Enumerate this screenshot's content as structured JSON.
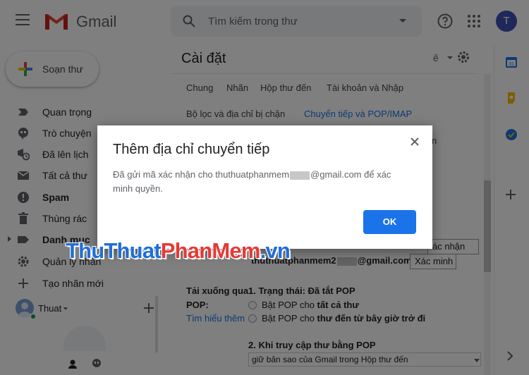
{
  "app": {
    "logo_text": "Gmail"
  },
  "search": {
    "placeholder": "Tìm kiếm trong thư"
  },
  "account": {
    "avatar_letter": "T"
  },
  "compose": {
    "label": "Soạn thư"
  },
  "sidebar": {
    "items": [
      {
        "label": "Quan trọng",
        "icon": "label-important-icon",
        "bold": false
      },
      {
        "label": "Trò chuyện",
        "icon": "chat-icon",
        "bold": false
      },
      {
        "label": "Đã lên lịch",
        "icon": "scheduled-icon",
        "bold": false
      },
      {
        "label": "Tất cả thư",
        "icon": "all-mail-icon",
        "bold": false
      },
      {
        "label": "Spam",
        "icon": "spam-icon",
        "bold": true
      },
      {
        "label": "Thùng rác",
        "icon": "trash-icon",
        "bold": false
      },
      {
        "label": "Danh mục",
        "icon": "category-icon",
        "bold": true
      },
      {
        "label": "Quản lý nhãn",
        "icon": "gear-icon",
        "bold": false
      },
      {
        "label": "Tạo nhãn mới",
        "icon": "plus-icon",
        "bold": false
      }
    ]
  },
  "hangouts": {
    "user": "Thuat"
  },
  "settings": {
    "title": "Cài đặt",
    "lang_glyph": "ê",
    "tabs": [
      {
        "label": "Chung",
        "active": false
      },
      {
        "label": "Nhãn",
        "active": false
      },
      {
        "label": "Hộp thư đến",
        "active": false
      },
      {
        "label": "Tài khoản và Nhập",
        "active": false
      },
      {
        "label": "Bộ lọc và địa chỉ bị chặn",
        "active": false
      },
      {
        "label": "Chuyển tiếp và POP/IMAP",
        "active": true
      }
    ],
    "partial_tab_n": "n",
    "verify_field": "ác nhận",
    "email_prefix": "thuthuatphanmem2",
    "email_suffix": "@gmail.com",
    "verify_button": "Xác minh",
    "pop_heading": "Tải xuống qua",
    "pop_label": "POP:",
    "learn_more": "Tìm hiểu thêm",
    "pop_status_prefix": "1. Trạng thái: ",
    "pop_status_value": "Đã tắt POP",
    "option1_prefix": "Bật POP cho ",
    "option1_bold": "tất cả thư",
    "option2_prefix": "Bật POP cho ",
    "option2_bold": "thư đến từ bây giờ trở đi",
    "section2": "2. Khi truy cập thư bằng POP",
    "section2_select": "giữ bản sao của Gmail trong Hộp thư đến"
  },
  "dialog": {
    "title": "Thêm địa chỉ chuyển tiếp",
    "body_prefix": "Đã gửi mã xác nhận cho thuthuatphanmem",
    "body_suffix": "@gmail.com để xác minh quyền.",
    "ok_label": "OK"
  },
  "watermark": {
    "part1": "ThuThuat",
    "part2": "PhanMem",
    "part3": ".vn"
  },
  "colors": {
    "accent": "#1a73e8",
    "avatar": "#3f51b5",
    "overlay": "rgba(0,0,0,0.5)"
  }
}
